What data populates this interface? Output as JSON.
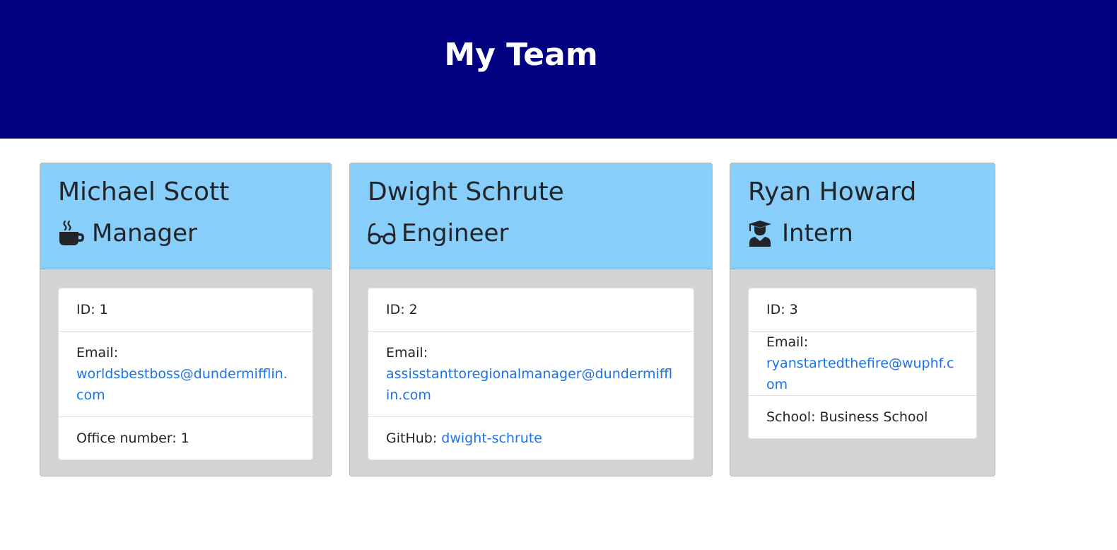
{
  "header": {
    "title": "My Team"
  },
  "employees": [
    {
      "name": "Michael Scott",
      "role": "Manager",
      "role_icon": "mug-hot-icon",
      "id_label": "ID: 1",
      "email_label": "Email:",
      "email": "worldsbestboss@dundermifflin.com",
      "extra_label": "Office number: 1",
      "extra_link": ""
    },
    {
      "name": "Dwight Schrute",
      "role": "Engineer",
      "role_icon": "glasses-icon",
      "id_label": "ID: 2",
      "email_label": "Email:",
      "email": "assisstanttoregionalmanager@dundermifflin.com",
      "extra_label": "GitHub:",
      "extra_link": "dwight-schrute"
    },
    {
      "name": "Ryan Howard",
      "role": "Intern",
      "role_icon": "user-graduate-icon",
      "id_label": "ID: 3",
      "email_label": "Email:",
      "email": "ryanstartedthefire@wuphf.com",
      "extra_label": "School: Business School",
      "extra_link": ""
    }
  ],
  "colors": {
    "header_bg": "#000080",
    "card_header_bg": "#87cefa",
    "card_body_bg": "#d3d3d3",
    "link": "#1a73e8"
  }
}
